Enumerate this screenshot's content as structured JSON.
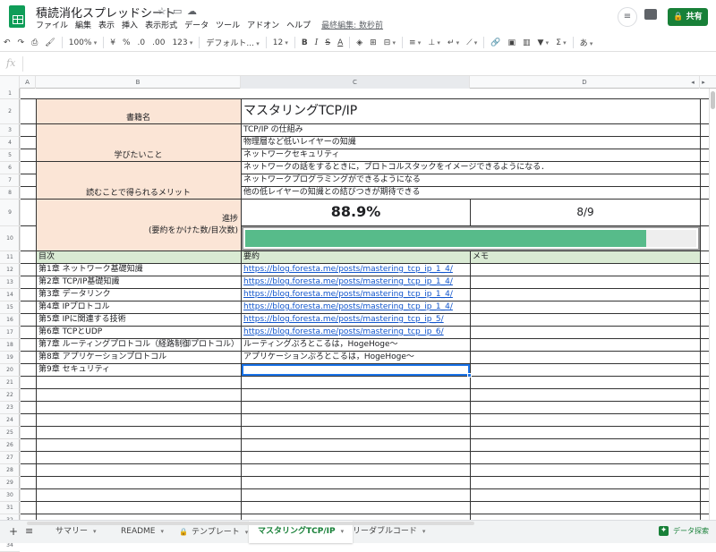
{
  "app": {
    "title": "積読消化スプレッドシート",
    "last_edit": "最終編集: 数秒前",
    "share_label": "共有"
  },
  "menus": [
    "ファイル",
    "編集",
    "表示",
    "挿入",
    "表示形式",
    "データ",
    "ツール",
    "アドオン",
    "ヘルプ"
  ],
  "toolbar": {
    "zoom": "100%",
    "currency": "¥",
    "percent": "%",
    "dec_less": ".0",
    "dec_more": ".00",
    "format_more": "123",
    "font": "デフォルト...",
    "font_size": "12",
    "input_tool": "あ"
  },
  "formula_bar": {
    "fx_label": "fx",
    "value": ""
  },
  "columns": [
    "A",
    "B",
    "C",
    "D"
  ],
  "rows": [
    "1",
    "2",
    "3",
    "4",
    "5",
    "6",
    "7",
    "8",
    "9",
    "10",
    "11",
    "12",
    "13",
    "14",
    "15",
    "16",
    "17",
    "18",
    "19",
    "20",
    "21",
    "22",
    "23",
    "24",
    "25",
    "26",
    "27",
    "28",
    "29",
    "30",
    "31",
    "32",
    "33",
    "34"
  ],
  "sheet": {
    "book_label": "書籍名",
    "book_title": "マスタリングTCP/IP",
    "learn_label": "学びたいこと",
    "learn": [
      "TCP/IP の仕組み",
      "物理層など低いレイヤーの知識",
      "ネットワークセキュリティ"
    ],
    "merit_label": "読むことで得られるメリット",
    "merit": [
      "ネットワークの話をするときに，プロトコルスタックをイメージできるようになる．",
      "ネットワークプログラミングができるようになる",
      "他の低レイヤーの知識との結びつきが期待できる"
    ],
    "progress_label": "進捗",
    "progress_sub": "(要約をかけた数/目次数)",
    "progress_pct": "88.9%",
    "progress_frac": "8/9",
    "progress_value": 0.889,
    "headers": {
      "toc": "目次",
      "summary": "要約",
      "memo": "メモ"
    },
    "toc": [
      {
        "ch": "第1章 ネットワーク基礎知識",
        "sum": "https://blog.foresta.me/posts/mastering_tcp_ip_1_4/",
        "link": true
      },
      {
        "ch": "第2章 TCP/IP基礎知識",
        "sum": "https://blog.foresta.me/posts/mastering_tcp_ip_1_4/",
        "link": true
      },
      {
        "ch": "第3章 データリンク",
        "sum": "https://blog.foresta.me/posts/mastering_tcp_ip_1_4/",
        "link": true
      },
      {
        "ch": "第4章 IPプロトコル",
        "sum": "https://blog.foresta.me/posts/mastering_tcp_ip_1_4/",
        "link": true
      },
      {
        "ch": "第5章 IPに関連する技術",
        "sum": "https://blog.foresta.me/posts/mastering_tcp_ip_5/",
        "link": true
      },
      {
        "ch": "第6章 TCPとUDP",
        "sum": "https://blog.foresta.me/posts/mastering_tcp_ip_6/",
        "link": true
      },
      {
        "ch": "第7章 ルーティングプロトコル（経路制御プロトコル）",
        "sum": "ルーティングぷろとこるは，HogeHoge〜",
        "link": false
      },
      {
        "ch": "第8章 アプリケーションプロトコル",
        "sum": "アプリケーションぷろとこるは，HogeHoge〜",
        "link": false
      },
      {
        "ch": "第9章 セキュリティ",
        "sum": "",
        "link": false
      }
    ]
  },
  "tabs": [
    "サマリー",
    "README",
    "テンプレート",
    "マスタリングTCP/IP",
    "リーダブルコード"
  ],
  "explore_label": "データ探索",
  "colors": {
    "label_bg": "#fbe5d6",
    "header_bg": "#d9ead3",
    "bar": "#57bb8a",
    "brand": "#188038"
  }
}
